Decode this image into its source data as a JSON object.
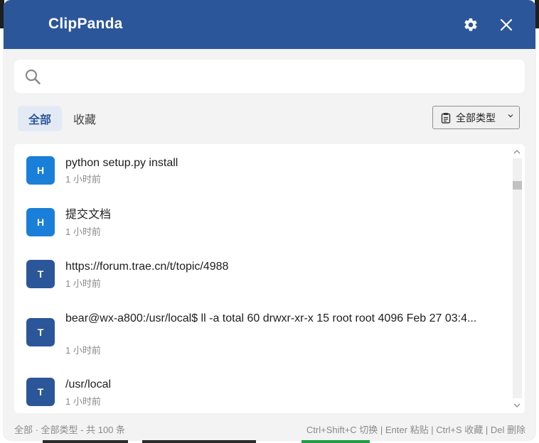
{
  "window": {
    "title": "ClipPanda"
  },
  "titlebar": {
    "settings_icon": "gear-icon",
    "close_icon": "close-icon"
  },
  "search": {
    "value": "",
    "placeholder": "",
    "icon": "search-icon"
  },
  "tabs": [
    {
      "label": "全部",
      "active": true
    },
    {
      "label": "收藏",
      "active": false
    }
  ],
  "type_filter": {
    "selected": "全部类型",
    "icon": "clipboard-icon"
  },
  "items": [
    {
      "badge": "H",
      "color": "#1a7fd8",
      "text": "python setup.py install",
      "time": "1 小时前"
    },
    {
      "badge": "H",
      "color": "#1a7fd8",
      "text": "提交文档",
      "time": "1 小时前"
    },
    {
      "badge": "T",
      "color": "#2c569a",
      "text": "https://forum.trae.cn/t/topic/4988",
      "time": "1 小时前"
    },
    {
      "badge": "T",
      "color": "#2c569a",
      "text": "bear@wx-a800:/usr/local$ ll -a total 60 drwxr-xr-x 15 root root 4096 Feb 27 03:4...",
      "time": "1 小时前"
    },
    {
      "badge": "T",
      "color": "#2c569a",
      "text": "/usr/local",
      "time": "1 小时前"
    }
  ],
  "status": {
    "left": "全部 · 全部类型 - 共 100 条",
    "right": "Ctrl+Shift+C 切换 | Enter 粘贴 | Ctrl+S 收藏 | Del 删除"
  },
  "colors": {
    "accent": "#2c569a",
    "html_badge": "#1a7fd8",
    "text_badge": "#2c569a"
  }
}
